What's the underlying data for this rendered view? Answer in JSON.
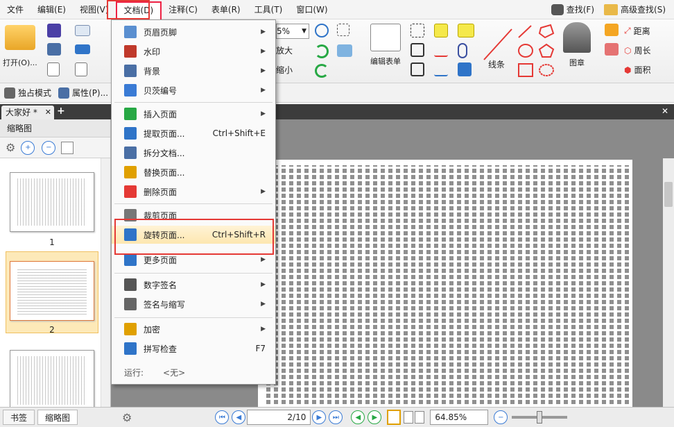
{
  "menubar": {
    "items": [
      "文件",
      "编辑(E)",
      "视图(V)",
      "文档(D)",
      "注释(C)",
      "表单(R)",
      "工具(T)",
      "窗口(W)"
    ],
    "find": "查找(F)",
    "advanced_find": "高级查找(S)"
  },
  "ribbon": {
    "open": "打开(O)...",
    "zoom_value": "5%",
    "zoom_in": "放大",
    "zoom_out": "缩小",
    "edit_form": "编辑表单",
    "line": "线条",
    "stamp": "图章",
    "distance": "距离",
    "perimeter": "周长",
    "area": "面积"
  },
  "subbar": {
    "exclusive": "独占模式",
    "properties": "属性(P)..."
  },
  "tab": {
    "title": "大家好 *"
  },
  "leftpanel": {
    "header": "缩略图",
    "thumb1": "1",
    "thumb2": "2"
  },
  "menu": {
    "items": [
      {
        "label": "页眉页脚",
        "shortcut": "",
        "submenu": true
      },
      {
        "label": "水印",
        "shortcut": "",
        "submenu": true
      },
      {
        "label": "背景",
        "shortcut": "",
        "submenu": true
      },
      {
        "label": "贝茨编号",
        "shortcut": "",
        "submenu": true
      },
      {
        "label": "插入页面",
        "shortcut": "",
        "submenu": true
      },
      {
        "label": "提取页面...",
        "shortcut": "Ctrl+Shift+E",
        "submenu": false
      },
      {
        "label": "拆分文档...",
        "shortcut": "",
        "submenu": false
      },
      {
        "label": "替换页面...",
        "shortcut": "",
        "submenu": false
      },
      {
        "label": "删除页面",
        "shortcut": "",
        "submenu": true
      },
      {
        "label": "裁剪页面",
        "shortcut": "",
        "submenu": false
      },
      {
        "label": "旋转页面...",
        "shortcut": "Ctrl+Shift+R",
        "submenu": false
      },
      {
        "label": "更多页面",
        "shortcut": "",
        "submenu": true
      },
      {
        "label": "数字签名",
        "shortcut": "",
        "submenu": true
      },
      {
        "label": "签名与缩写",
        "shortcut": "",
        "submenu": true
      },
      {
        "label": "加密",
        "shortcut": "",
        "submenu": true
      },
      {
        "label": "拼写检查",
        "shortcut": "F7",
        "submenu": false
      }
    ],
    "footer_label": "运行:",
    "footer_value": "<无>"
  },
  "statusbar": {
    "bookmarks": "书签",
    "thumbnails": "缩略图",
    "page_current": "2",
    "page_total": "10",
    "zoom": "64.85%"
  },
  "colors": {
    "accent_red": "#e53935",
    "highlight": "#fde7b0"
  }
}
